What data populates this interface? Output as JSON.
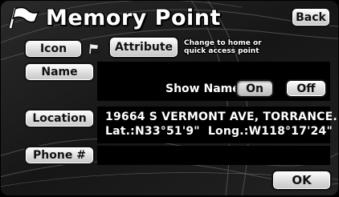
{
  "header": {
    "title": "Memory Point",
    "back_label": "Back"
  },
  "toolbar": {
    "icon_label": "Icon",
    "attribute_label": "Attribute",
    "hint_line1": "Change to home or",
    "hint_line2": "quick access point"
  },
  "name": {
    "button_label": "Name",
    "show_name_label": "Show Name",
    "on_label": "On",
    "off_label": "Off",
    "selected": "On"
  },
  "location": {
    "button_label": "Location",
    "address": "19664 S VERMONT AVE, TORRANCE...",
    "coords": "Lat.:N33°51'9\"  Long.:W118°17'24\""
  },
  "phone": {
    "button_label": "Phone #",
    "value": ""
  },
  "footer": {
    "ok_label": "OK"
  }
}
